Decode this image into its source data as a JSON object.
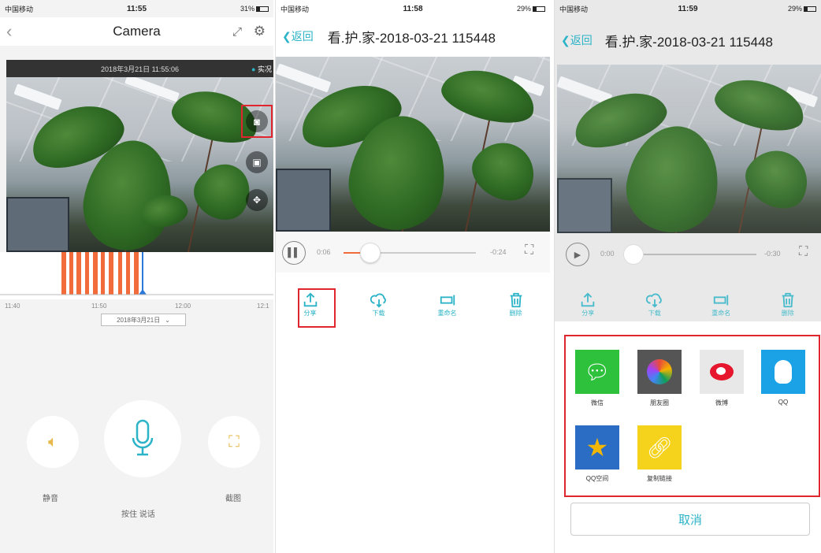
{
  "panel1": {
    "status": {
      "carrier": "中国移动",
      "time": "11:55",
      "battery": "31%"
    },
    "nav": {
      "back_icon": "chevron-left-icon",
      "title": "Camera",
      "fullscreen_icon": "expand-icon",
      "settings_icon": "gear-icon"
    },
    "video": {
      "timestamp": "2018年3月21日 11:55:06",
      "live_label": "实况"
    },
    "timeline": {
      "ticks": [
        "11:40",
        "11:50",
        "12:00",
        "12:1"
      ],
      "date_select": "2018年3月21日"
    },
    "controls": {
      "mute_label": "静音",
      "talk_label": "按住 说话",
      "snapshot_label": "截图"
    }
  },
  "panel2": {
    "status": {
      "carrier": "中国移动",
      "time": "11:58",
      "battery": "29%"
    },
    "nav": {
      "back_label": "返回",
      "title": "看.护.家-2018-03-21 115448"
    },
    "player": {
      "elapsed": "0:06",
      "remaining": "-0:24",
      "progress": 0.2
    },
    "actions": [
      {
        "label": "分享",
        "icon": "share-icon"
      },
      {
        "label": "下载",
        "icon": "cloud-download-icon"
      },
      {
        "label": "重命名",
        "icon": "rename-icon"
      },
      {
        "label": "删除",
        "icon": "trash-icon"
      }
    ]
  },
  "panel3": {
    "status": {
      "carrier": "中国移动",
      "time": "11:59",
      "battery": "29%"
    },
    "nav": {
      "back_label": "返回",
      "title": "看.护.家-2018-03-21 115448"
    },
    "player": {
      "elapsed": "0:00",
      "remaining": "-0:30",
      "progress": 0.0
    },
    "actions": [
      {
        "label": "分享",
        "icon": "share-icon"
      },
      {
        "label": "下载",
        "icon": "cloud-download-icon"
      },
      {
        "label": "重命名",
        "icon": "rename-icon"
      },
      {
        "label": "删除",
        "icon": "trash-icon"
      }
    ],
    "share_targets": [
      {
        "label": "微信",
        "icon": "wechat-icon",
        "color": "#2ec13c"
      },
      {
        "label": "朋友圈",
        "icon": "moments-icon",
        "color": "#555555"
      },
      {
        "label": "微博",
        "icon": "weibo-icon",
        "color": "#e6162d"
      },
      {
        "label": "QQ",
        "icon": "qq-icon",
        "color": "#1ba1e6"
      },
      {
        "label": "QQ空间",
        "icon": "qzone-icon",
        "color": "#f2b705"
      },
      {
        "label": "复制链接",
        "icon": "link-icon",
        "color": "#f5d21b"
      }
    ],
    "cancel_label": "取消"
  },
  "colors": {
    "accent": "#2bb3c7",
    "highlight": "#e0252f",
    "progress": "#f26b3a"
  }
}
